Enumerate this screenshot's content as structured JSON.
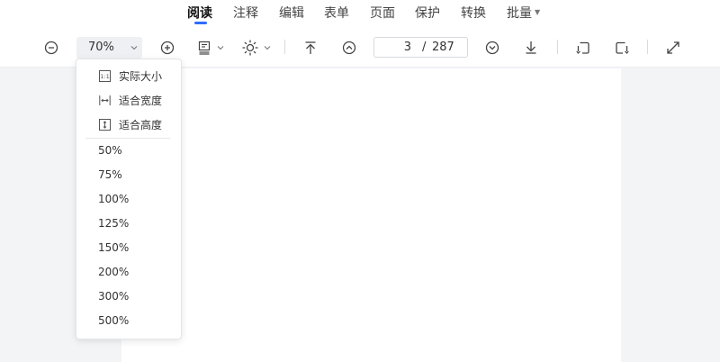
{
  "menu": {
    "tabs": [
      {
        "label": "阅读",
        "active": true
      },
      {
        "label": "注释"
      },
      {
        "label": "编辑"
      },
      {
        "label": "表单"
      },
      {
        "label": "页面"
      },
      {
        "label": "保护"
      },
      {
        "label": "转换"
      },
      {
        "label": "批量",
        "has_dropdown": true
      }
    ]
  },
  "toolbar": {
    "zoom_value": "70%",
    "page_current": "3",
    "page_separator": "/",
    "page_total": "287",
    "icons": [
      "zoom-out-icon",
      "zoom-in-icon",
      "page-layout-icon",
      "brightness-icon",
      "first-page-icon",
      "previous-page-icon",
      "next-page-icon",
      "last-page-icon",
      "rotate-left-icon",
      "rotate-right-icon",
      "fullscreen-icon"
    ]
  },
  "zoom_menu": {
    "fit_options": [
      {
        "label": "实际大小",
        "icon": "actual-size-icon"
      },
      {
        "label": "适合宽度",
        "icon": "fit-width-icon"
      },
      {
        "label": "适合高度",
        "icon": "fit-height-icon"
      }
    ],
    "percent_options": [
      "50%",
      "75%",
      "100%",
      "125%",
      "150%",
      "200%",
      "300%",
      "500%"
    ]
  },
  "colors": {
    "accent": "#2f6bff",
    "toolbar_bg": "#ffffff",
    "canvas_bg": "#f3f4f6",
    "page_bg": "#ffffff"
  }
}
